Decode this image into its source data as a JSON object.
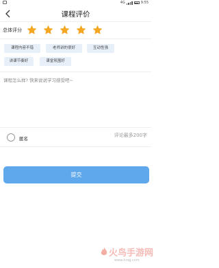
{
  "status_bar": {
    "signal": "4G",
    "time": "9:55"
  },
  "header": {
    "title": "课程评价"
  },
  "rating": {
    "label": "总体评分",
    "stars_filled": 5,
    "stars_total": 5,
    "star_color": "#f5a623"
  },
  "tags": [
    {
      "label": "课程内容不错"
    },
    {
      "label": "老师讲的很好"
    },
    {
      "label": "互动性强"
    },
    {
      "label": "讲课节奏好"
    },
    {
      "label": "课堂氛围好"
    }
  ],
  "comment": {
    "placeholder": "课程怎么样? 快来说说学习感受吧~",
    "value": ""
  },
  "anonymous": {
    "label": "匿名",
    "checked": false
  },
  "limit_hint": "评论最多200字",
  "submit": {
    "label": "提交",
    "color": "#5fa8ec"
  },
  "watermark": {
    "text": "火鸟手游网",
    "url": "www.hnqj.com"
  }
}
